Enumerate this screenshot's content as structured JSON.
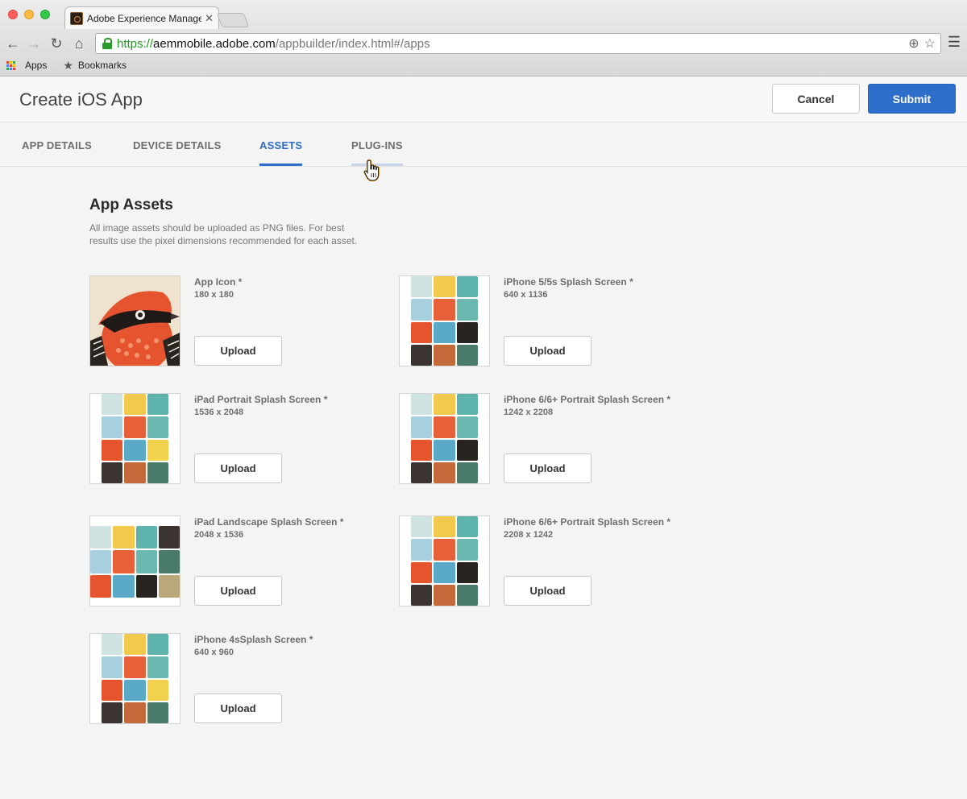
{
  "browser": {
    "tab_title": "Adobe Experience Manager",
    "tab_close": "✕",
    "url_scheme": "https://",
    "url_host": "aemmobile.adobe.com",
    "url_path": "/appbuilder/index.html#/apps",
    "bookmarks": [
      "Apps",
      "Bookmarks"
    ],
    "icons": [
      "back-icon",
      "forward-icon",
      "reload-icon",
      "home-icon",
      "lock-icon",
      "zoom-icon",
      "star-icon",
      "menu-icon"
    ]
  },
  "header": {
    "title": "Create iOS App",
    "cancel_label": "Cancel",
    "submit_label": "Submit",
    "accent_color": "#2d6ecb"
  },
  "tabs": [
    {
      "label": "APP DETAILS"
    },
    {
      "label": "DEVICE DETAILS"
    },
    {
      "label": "ASSETS"
    },
    {
      "label": "PLUG-INS"
    }
  ],
  "main": {
    "section_title": "App Assets",
    "section_desc": "All image assets should be uploaded as PNG files. For best results use the pixel dimensions recommended for each asset.",
    "upload_label": "Upload",
    "assets": [
      {
        "name": "App Icon *",
        "dims": "180 x 180"
      },
      {
        "name": "iPhone 5/5s Splash Screen *",
        "dims": "640 x 1136"
      },
      {
        "name": "iPad Portrait  Splash Screen *",
        "dims": "1536 x 2048"
      },
      {
        "name": "iPhone 6/6+ Portrait Splash Screen *",
        "dims": "1242 x 2208"
      },
      {
        "name": "iPad Landscape  Splash Screen *",
        "dims": "2048 x 1536"
      },
      {
        "name": "iPhone 6/6+ Portrait Splash Screen *",
        "dims": "2208 x 1242"
      },
      {
        "name": "iPhone 4sSplash Screen *",
        "dims": "640 x 960"
      }
    ]
  }
}
